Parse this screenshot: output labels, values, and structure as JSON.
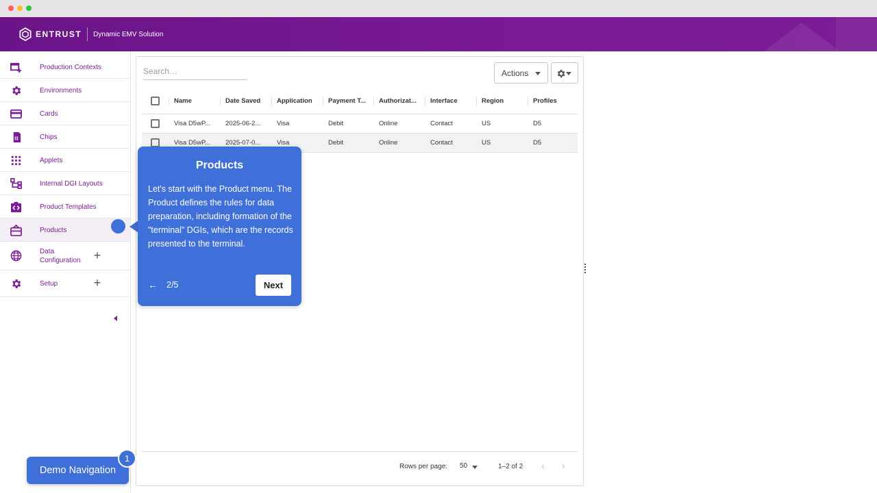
{
  "header": {
    "brand": "ENTRUST",
    "product": "Dynamic EMV Solution"
  },
  "sidebar": {
    "items": [
      {
        "label": "Production Contexts",
        "icon": "production-contexts-icon"
      },
      {
        "label": "Environments",
        "icon": "gear-icon"
      },
      {
        "label": "Cards",
        "icon": "card-icon"
      },
      {
        "label": "Chips",
        "icon": "chip-icon"
      },
      {
        "label": "Applets",
        "icon": "grid-icon"
      },
      {
        "label": "Internal DGI Layouts",
        "icon": "layout-tree-icon"
      },
      {
        "label": "Product Templates",
        "icon": "template-icon"
      },
      {
        "label": "Products",
        "icon": "products-icon"
      },
      {
        "label_line1": "Data",
        "label_line2": "Configuration",
        "icon": "globe-icon"
      },
      {
        "label": "Setup",
        "icon": "gear-icon"
      }
    ]
  },
  "main": {
    "search_placeholder": "Search…",
    "actions_label": "Actions",
    "columns": [
      "Name",
      "Date Saved",
      "Application",
      "Payment T...",
      "Authorizat...",
      "Interface",
      "Region",
      "Profiles"
    ],
    "rows": [
      [
        "Visa D5wP...",
        "2025-06-2...",
        "Visa",
        "Debit",
        "Online",
        "Contact",
        "US",
        "D5"
      ],
      [
        "Visa D5wP...",
        "2025-07-0...",
        "Visa",
        "Debit",
        "Online",
        "Contact",
        "US",
        "D5"
      ]
    ],
    "footer": {
      "rows_per_page_label": "Rows per page:",
      "rows_per_page_value": "50",
      "range": "1–2 of 2"
    }
  },
  "tour": {
    "title": "Products",
    "body": "Let's start with the Product menu. The Product defines the rules for data preparation, including formation of the \"terminal\" DGIs, which are the records presented to the terminal.",
    "back_arrow": "←",
    "step": "2/5",
    "next_label": "Next"
  },
  "demo_nav": {
    "label": "Demo Navigation",
    "badge": "1"
  },
  "colors": {
    "brand_purple": "#7b1d96",
    "tour_blue": "#3f6fd8"
  }
}
